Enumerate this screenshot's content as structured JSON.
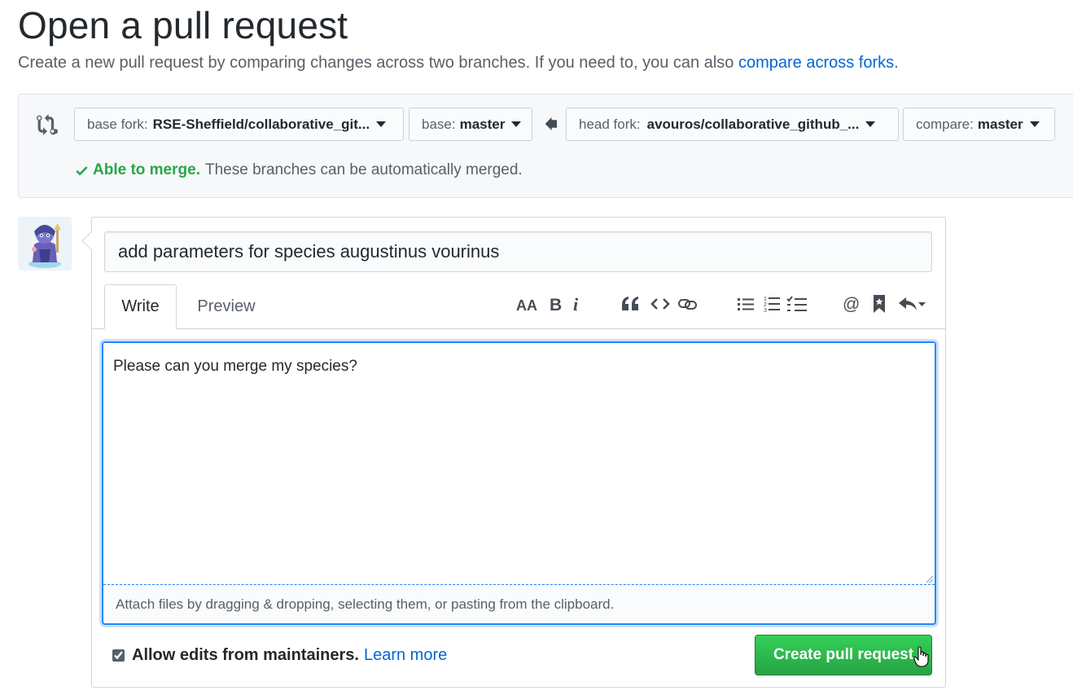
{
  "header": {
    "title": "Open a pull request",
    "subtitle_prefix": "Create a new pull request by comparing changes across two branches. If you need to, you can also ",
    "subtitle_link": "compare across forks",
    "subtitle_suffix": "."
  },
  "range": {
    "base_fork_label": "base fork:",
    "base_fork_value": "RSE-Sheffield/collaborative_git...",
    "base_label": "base:",
    "base_value": "master",
    "head_fork_label": "head fork:",
    "head_fork_value": "avouros/collaborative_github_...",
    "compare_label": "compare:",
    "compare_value": "master",
    "merge_ok": "Able to merge.",
    "merge_text": "These branches can be automatically merged.",
    "merge_color": "#28a745"
  },
  "form": {
    "title_value": "add parameters for species augustinus vourinus",
    "tabs": [
      {
        "label": "Write",
        "selected": true
      },
      {
        "label": "Preview",
        "selected": false
      }
    ],
    "toolbar": [
      "text-size-icon",
      "bold-icon",
      "italic-icon",
      "quote-icon",
      "code-icon",
      "link-icon",
      "unordered-list-icon",
      "ordered-list-icon",
      "task-list-icon",
      "mention-icon",
      "bookmark-icon",
      "reply-icon"
    ],
    "body_value": "Please can you merge my species?",
    "attach_hint": "Attach files by dragging & dropping, selecting them, or pasting from the clipboard.",
    "allow_edits_label": "Allow edits from maintainers.",
    "allow_edits_checked": true,
    "learn_more": "Learn more",
    "submit_label": "Create pull request",
    "submit_color": "#28a745"
  }
}
